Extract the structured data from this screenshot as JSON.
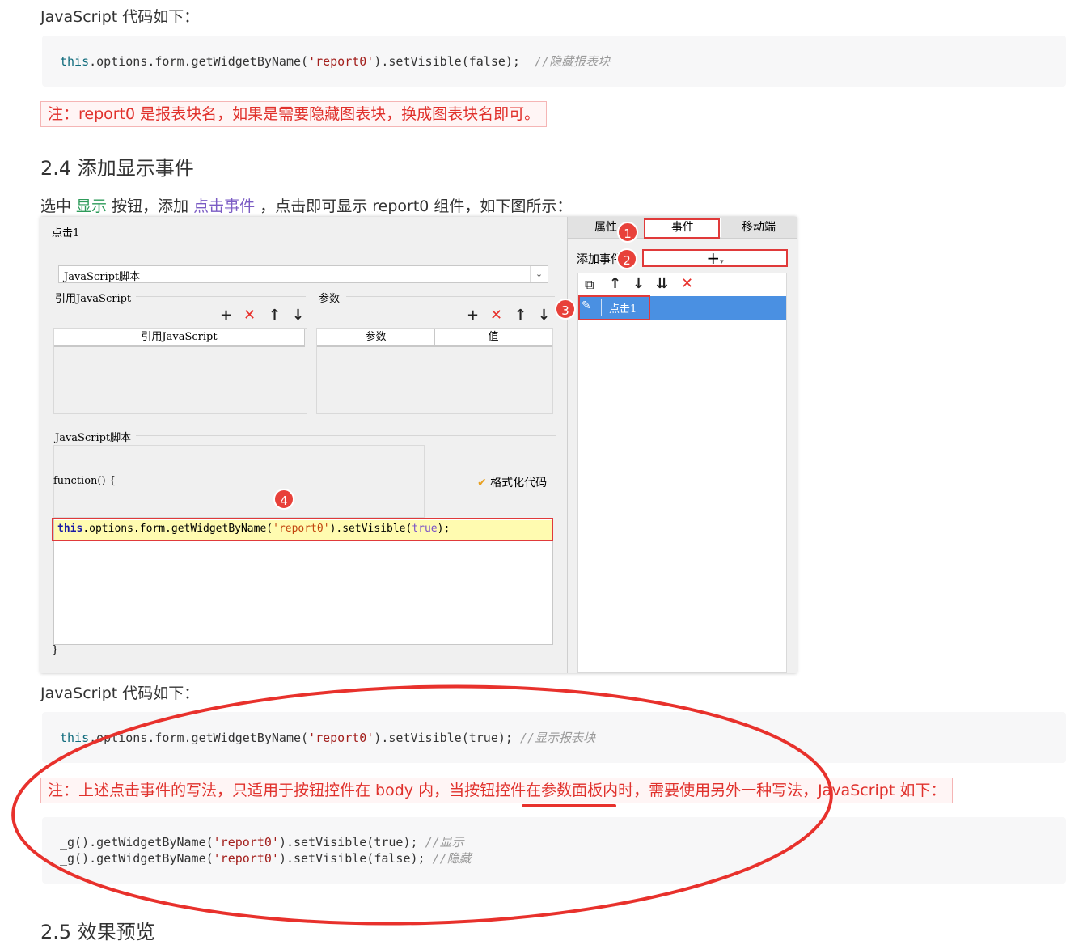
{
  "top_label": "JavaScript 代码如下：",
  "code1": {
    "kw": "this",
    "a": ".options.form.getWidgetByName(",
    "str": "'report0'",
    "b": ").setVisible(false);",
    "cmt": "//隐藏报表块"
  },
  "note1": "注：report0 是报表块名，如果是需要隐藏图表块，换成图表块名即可。",
  "heading_24": "2.4 添加显示事件",
  "para": {
    "p1": "选中 ",
    "show": "显示",
    "p2": " 按钮，添加 ",
    "event": "点击事件",
    "p3": " ，点击即可显示 report0 组件，如下图所示："
  },
  "screenshot": {
    "title": "点击1",
    "select_value": "JavaScript脚本",
    "ref_js_label": "引用JavaScript",
    "params_label": "参数",
    "col_ref_js": "引用JavaScript",
    "col_param": "参数",
    "col_value": "值",
    "script_label": "JavaScript脚本",
    "func_open": "function() {",
    "func_close": "}",
    "format_code": "格式化代码",
    "code_kw": "this",
    "code_a": ".options.form.getWidgetByName(",
    "code_str": "'report0'",
    "code_b": ").setVisible(",
    "code_bool": "true",
    "code_c": ");",
    "tabs": [
      "属性",
      "事件",
      "移动端"
    ],
    "add_event_label": "添加事件",
    "add_symbol": "+",
    "event_item": "点击1",
    "badges": [
      "1",
      "2",
      "3",
      "4"
    ],
    "icons": {
      "add": "+",
      "delete": "✕",
      "up": "↑",
      "down": "↓"
    }
  },
  "js_label2": "JavaScript 代码如下：",
  "code2": {
    "kw": "this",
    "a": ".options.form.getWidgetByName(",
    "str": "'report0'",
    "b": ").setVisible(true);",
    "cmt": "//显示报表块"
  },
  "note2": "注：上述点击事件的写法，只适用于按钮控件在 body 内，当按钮控件在参数面板内时，需要使用另外一种写法，JavaScript 如下：",
  "code3": [
    {
      "a": "_g().getWidgetByName(",
      "str": "'report0'",
      "b": ").setVisible(true);",
      "cmt": "//显示"
    },
    {
      "a": "_g().getWidgetByName(",
      "str": "'report0'",
      "b": ").setVisible(false);",
      "cmt": "//隐藏"
    }
  ],
  "heading_25": "2.5 效果预览",
  "colors": {
    "annotation_red": "#e8312c",
    "highlight_blue": "#4a90e2",
    "note_text": "#e0312c"
  }
}
